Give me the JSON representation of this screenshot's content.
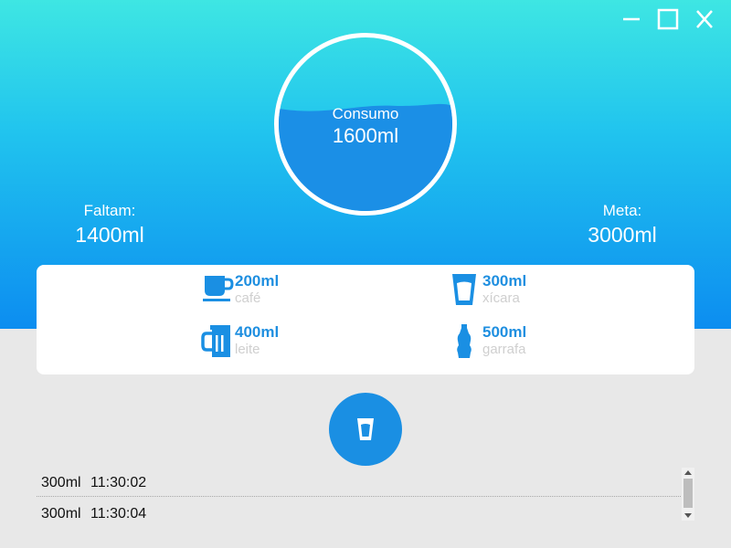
{
  "window": {
    "controls": [
      "minimize-icon",
      "maximize-icon",
      "close-icon"
    ]
  },
  "consumption": {
    "label": "Consumo",
    "value": "1600ml",
    "fill_fraction": 0.533
  },
  "remaining": {
    "label": "Faltam:",
    "value": "1400ml"
  },
  "goal": {
    "label": "Meta:",
    "value": "3000ml"
  },
  "drinks": [
    {
      "amount": "200ml",
      "name": "café",
      "icon": "coffee-cup-icon"
    },
    {
      "amount": "300ml",
      "name": "xícara",
      "icon": "glass-icon"
    },
    {
      "amount": "400ml",
      "name": "leite",
      "icon": "mug-icon"
    },
    {
      "amount": "500ml",
      "name": "garrafa",
      "icon": "bottle-icon"
    }
  ],
  "add_button": {
    "icon": "glass-icon"
  },
  "history": [
    {
      "amount": "300ml",
      "time": "11:30:02"
    },
    {
      "amount": "300ml",
      "time": "11:30:04"
    }
  ],
  "colors": {
    "accent": "#1a8fe3",
    "hero_top": "#3ee6e3",
    "hero_bottom": "#0c8df0",
    "background": "#e8e8e8",
    "drink_name": "#cfcfcf"
  }
}
